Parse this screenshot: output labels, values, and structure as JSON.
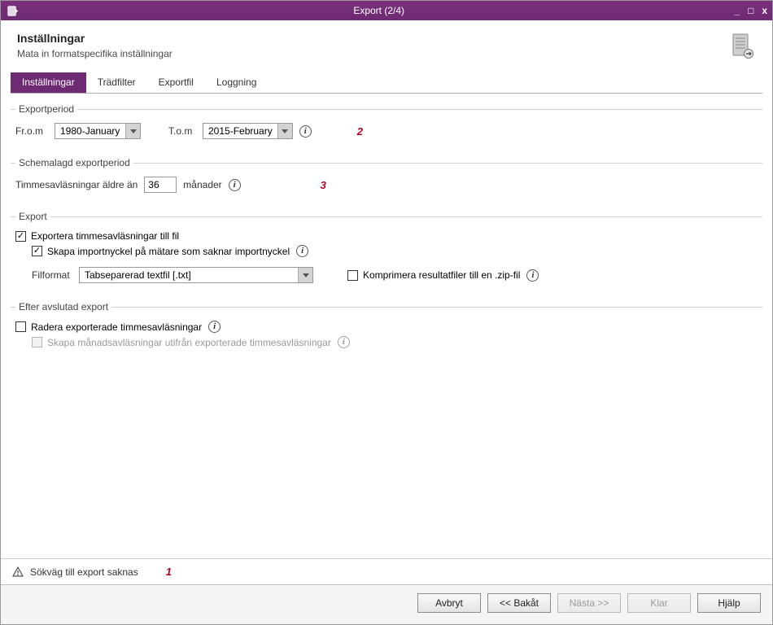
{
  "window": {
    "title": "Export (2/4)"
  },
  "header": {
    "title": "Inställningar",
    "subtitle": "Mata in formatspecifika inställningar"
  },
  "tabs": [
    {
      "label": "Inställningar",
      "active": true
    },
    {
      "label": "Trädfilter",
      "active": false
    },
    {
      "label": "Exportfil",
      "active": false
    },
    {
      "label": "Loggning",
      "active": false
    }
  ],
  "exportperiod": {
    "legend": "Exportperiod",
    "from_label": "Fr.o.m",
    "from_value": "1980-January",
    "to_label": "T.o.m",
    "to_value": "2015-February",
    "annotation": "2"
  },
  "schemalagd": {
    "legend": "Schemalagd exportperiod",
    "label_before": "Timmesavläsningar äldre än",
    "value": "36",
    "label_after": "månader",
    "annotation": "3"
  },
  "export": {
    "legend": "Export",
    "chk_export_label": "Exportera timmesavläsningar till fil",
    "chk_importkey_label": "Skapa importnyckel på mätare som saknar importnyckel",
    "filformat_label": "Filformat",
    "filformat_value": "Tabseparerad textfil [.txt]",
    "chk_compress_label": "Komprimera resultatfiler till en .zip-fil"
  },
  "after_export": {
    "legend": "Efter avslutad export",
    "chk_delete_label": "Radera exporterade timmesavläsningar",
    "chk_create_month_label": "Skapa månadsavläsningar utifrån exporterade timmesavläsningar"
  },
  "warning": {
    "text": "Sökväg till export saknas",
    "annotation": "1"
  },
  "footer": {
    "cancel": "Avbryt",
    "back": "<< Bakåt",
    "next": "Nästa >>",
    "finish": "Klar",
    "help": "Hjälp"
  }
}
